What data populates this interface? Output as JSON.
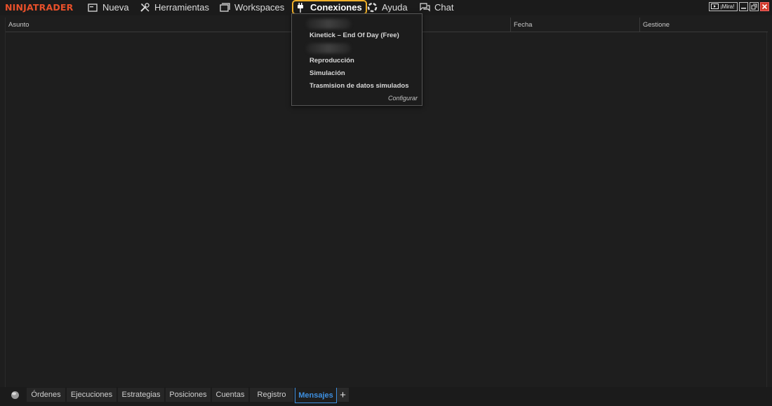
{
  "app": {
    "logo": "NINJATRADER"
  },
  "menu": {
    "nueva": "Nueva",
    "herramientas": "Herramientas",
    "workspaces": "Workspaces",
    "conexiones": "Conexiones",
    "ayuda": "Ayuda",
    "chat": "Chat"
  },
  "window_controls": {
    "mira": "¡Mira!"
  },
  "grid": {
    "columns": [
      "Asunto",
      "Fecha",
      "Gestione"
    ]
  },
  "connections_menu": {
    "items": [
      {
        "label": "Kinetick – End Of Day (Free)"
      },
      {
        "label": "Reproducción"
      },
      {
        "label": "Simulación"
      },
      {
        "label": "Trasmision de datos simulados"
      }
    ],
    "configure": "Configurar"
  },
  "bottom_tabs": {
    "tabs": [
      "Órdenes",
      "Ejecuciones",
      "Estrategias",
      "Posiciones",
      "Cuentas",
      "Registro",
      "Mensajes"
    ],
    "active": "Mensajes",
    "add": "+"
  },
  "colors": {
    "accent_highlight": "#f0b02a",
    "active_tab": "#3d8fe0",
    "logo": "#e8502a",
    "close_button": "#d23a2a"
  },
  "icons": [
    "new-window-icon",
    "tools-icon",
    "workspaces-icon",
    "plug-icon",
    "help-lifebuoy-icon",
    "chat-icon",
    "globe-icon",
    "video-icon"
  ]
}
